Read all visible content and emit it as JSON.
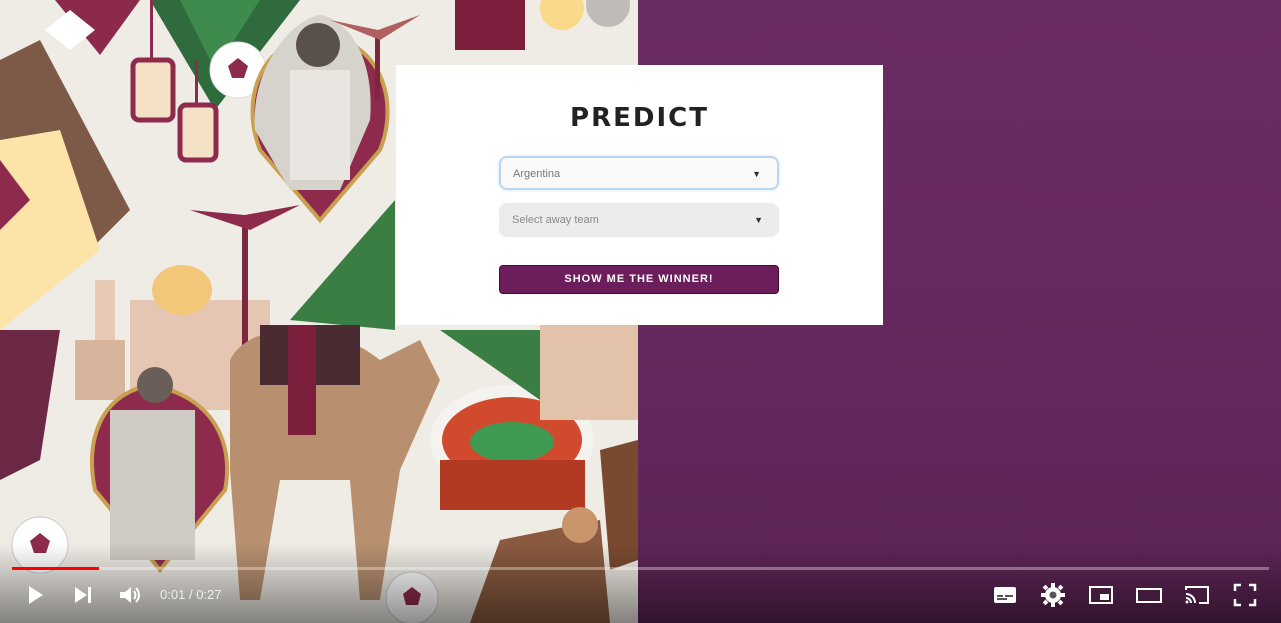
{
  "card": {
    "title": "PREDICT",
    "home_select": {
      "value": "Argentina"
    },
    "away_select": {
      "placeholder": "Select away team"
    },
    "button_label": "SHOW ME THE WINNER!"
  },
  "player": {
    "current_time": "0:01",
    "separator": "/",
    "duration": "0:27",
    "progress_fraction": 0.0037
  },
  "colors": {
    "accent": "#6b1d5c",
    "background_purple": "#66295f",
    "progress": "#ff0000"
  },
  "icons": [
    "play-icon",
    "next-icon",
    "volume-icon",
    "subtitles-icon",
    "settings-icon",
    "miniplayer-icon",
    "theater-icon",
    "cast-icon",
    "fullscreen-icon"
  ]
}
